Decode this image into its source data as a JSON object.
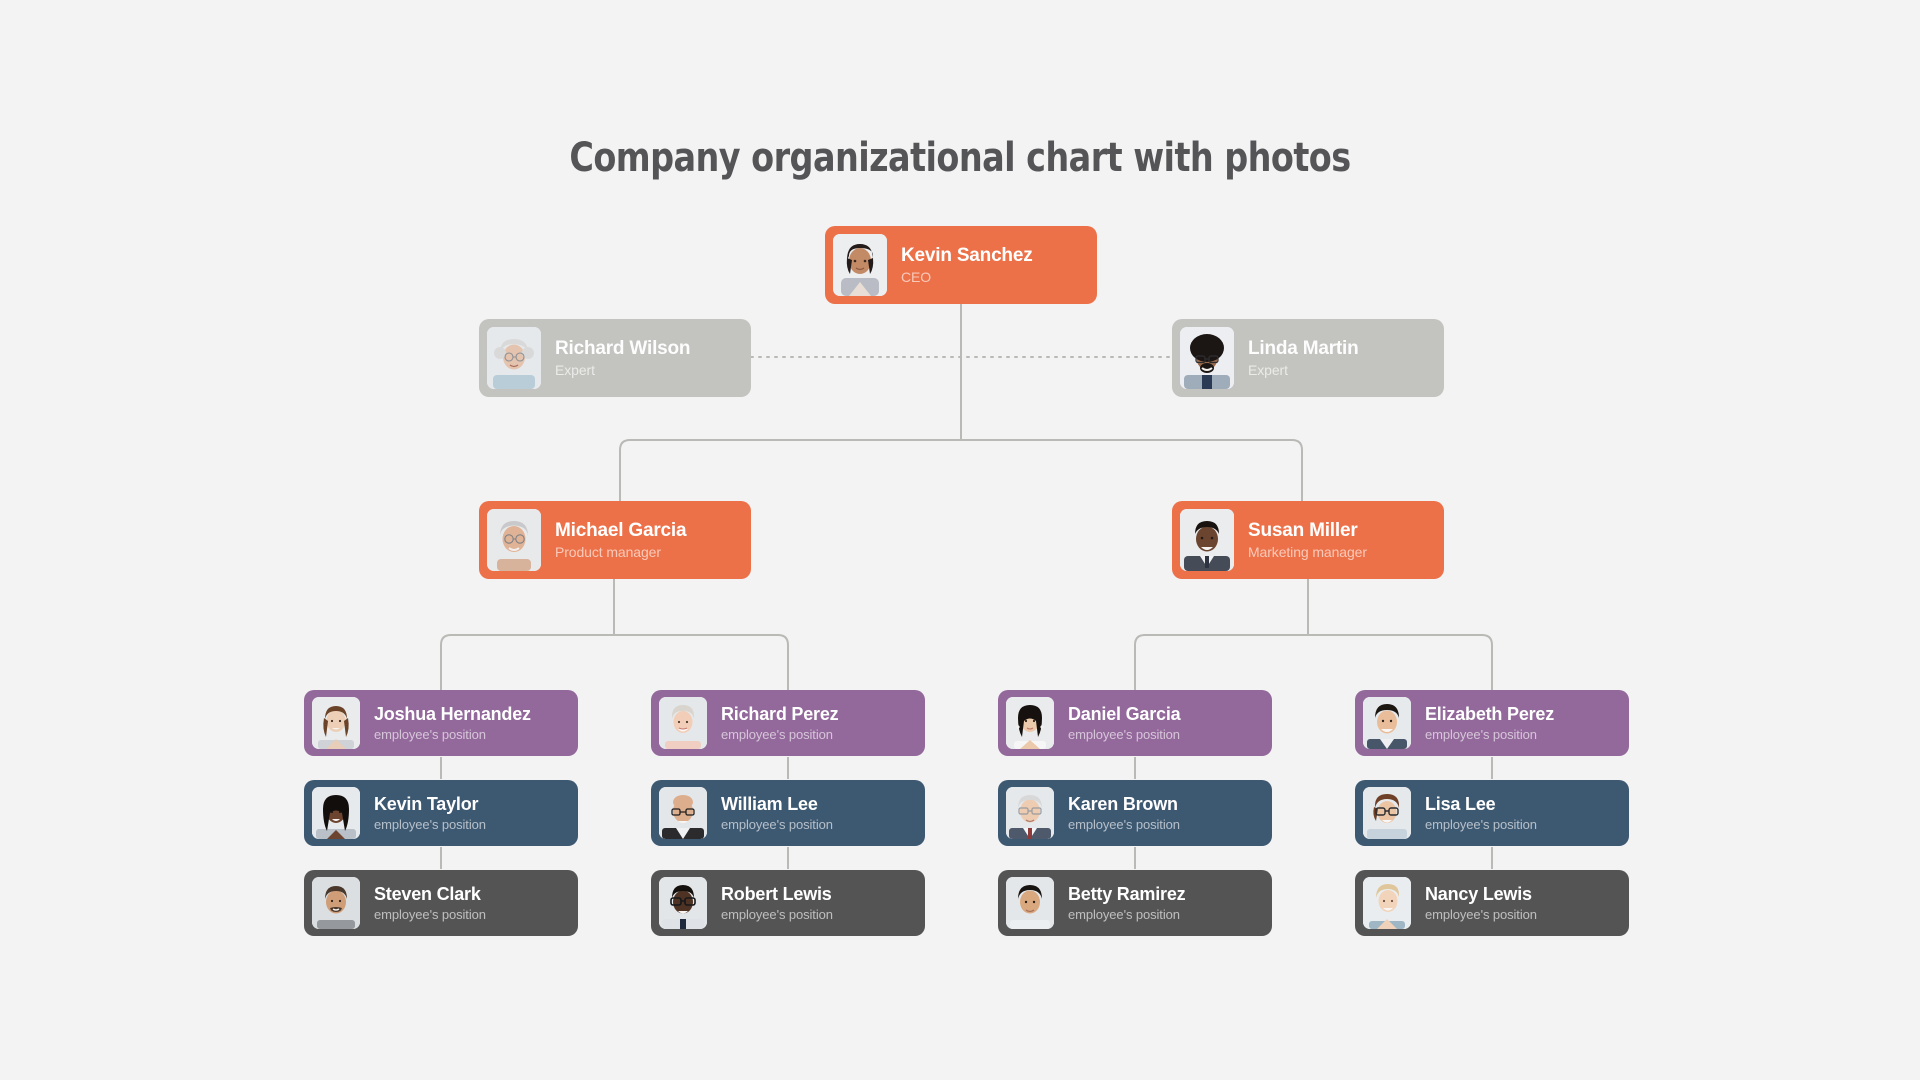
{
  "page": {
    "title": "Company organizational chart with photos",
    "background_color": "#f4f3f4",
    "title_color": "#555456"
  },
  "palette": {
    "orange": "#ec7149",
    "gray": "#c3c4bf",
    "purple": "#93689b",
    "slate": "#3d5871",
    "dark": "#545454",
    "connector": "#b9bab5"
  },
  "chart_data": {
    "type": "diagram",
    "diagram_kind": "organizational-chart",
    "title": "Company organizational chart with photos",
    "nodes": [
      {
        "id": "ceo",
        "name": "Kevin Sanchez",
        "role": "CEO",
        "level": 0,
        "color": "#ec7149",
        "photo": "woman-dark-hair"
      },
      {
        "id": "exp1",
        "name": "Richard Wilson",
        "role": "Expert",
        "level": 1,
        "color": "#c3c4bf",
        "photo": "elderly-woman-glasses"
      },
      {
        "id": "exp2",
        "name": "Linda Martin",
        "role": "Expert",
        "level": 1,
        "color": "#c3c4bf",
        "photo": "man-afro-glasses"
      },
      {
        "id": "mgr1",
        "name": "Michael Garcia",
        "role": "Product manager",
        "level": 2,
        "color": "#ec7149",
        "photo": "older-man-glasses"
      },
      {
        "id": "mgr2",
        "name": "Susan Miller",
        "role": "Marketing manager",
        "level": 2,
        "color": "#ec7149",
        "photo": "man-suit-smiling"
      },
      {
        "id": "e1a",
        "name": "Joshua Hernandez",
        "role": "employee's position",
        "level": 3,
        "color": "#93689b",
        "photo": "woman-brown-hair"
      },
      {
        "id": "e1b",
        "name": "Kevin Taylor",
        "role": "employee's position",
        "level": 3,
        "color": "#3d5871",
        "photo": "woman-long-dark-hair"
      },
      {
        "id": "e1c",
        "name": "Steven Clark",
        "role": "employee's position",
        "level": 3,
        "color": "#545454",
        "photo": "man-beard-grey-shirt"
      },
      {
        "id": "e2a",
        "name": "Richard Perez",
        "role": "employee's position",
        "level": 3,
        "color": "#93689b",
        "photo": "elderly-woman-blonde"
      },
      {
        "id": "e2b",
        "name": "William Lee",
        "role": "employee's position",
        "level": 3,
        "color": "#3d5871",
        "photo": "bald-man-glasses"
      },
      {
        "id": "e2c",
        "name": "Robert Lewis",
        "role": "employee's position",
        "level": 3,
        "color": "#545454",
        "photo": "man-black-glasses-tie"
      },
      {
        "id": "e3a",
        "name": "Daniel Garcia",
        "role": "employee's position",
        "level": 3,
        "color": "#93689b",
        "photo": "woman-earrings"
      },
      {
        "id": "e3b",
        "name": "Karen Brown",
        "role": "employee's position",
        "level": 3,
        "color": "#3d5871",
        "photo": "elderly-man-suit"
      },
      {
        "id": "e3c",
        "name": "Betty Ramirez",
        "role": "employee's position",
        "level": 3,
        "color": "#545454",
        "photo": "man-dark-hair-white-shirt"
      },
      {
        "id": "e4a",
        "name": "Elizabeth Perez",
        "role": "employee's position",
        "level": 3,
        "color": "#93689b",
        "photo": "young-man-smiling"
      },
      {
        "id": "e4b",
        "name": "Lisa Lee",
        "role": "employee's position",
        "level": 3,
        "color": "#3d5871",
        "photo": "woman-short-hair-glasses"
      },
      {
        "id": "e4c",
        "name": "Nancy Lewis",
        "role": "employee's position",
        "level": 3,
        "color": "#545454",
        "photo": "blonde-woman-smiling"
      }
    ],
    "edges": [
      {
        "from": "ceo",
        "to": "mgr1",
        "style": "solid"
      },
      {
        "from": "ceo",
        "to": "mgr2",
        "style": "solid"
      },
      {
        "from": "exp1",
        "to": "exp2",
        "style": "dotted"
      },
      {
        "from": "mgr1",
        "to": "e1a",
        "style": "solid"
      },
      {
        "from": "mgr1",
        "to": "e2a",
        "style": "solid"
      },
      {
        "from": "mgr2",
        "to": "e3a",
        "style": "solid"
      },
      {
        "from": "mgr2",
        "to": "e4a",
        "style": "solid"
      },
      {
        "from": "e1a",
        "to": "e1b",
        "style": "solid"
      },
      {
        "from": "e1b",
        "to": "e1c",
        "style": "solid"
      },
      {
        "from": "e2a",
        "to": "e2b",
        "style": "solid"
      },
      {
        "from": "e2b",
        "to": "e2c",
        "style": "solid"
      },
      {
        "from": "e3a",
        "to": "e3b",
        "style": "solid"
      },
      {
        "from": "e3b",
        "to": "e3c",
        "style": "solid"
      },
      {
        "from": "e4a",
        "to": "e4b",
        "style": "solid"
      },
      {
        "from": "e4b",
        "to": "e4c",
        "style": "solid"
      }
    ]
  }
}
